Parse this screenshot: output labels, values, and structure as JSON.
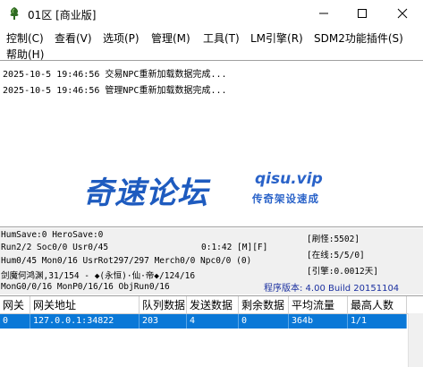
{
  "window": {
    "title": "01区 [商业版]",
    "icons": {
      "app": "tree-app-icon",
      "minimize": "minimize-icon",
      "maximize": "maximize-icon",
      "close": "close-icon"
    }
  },
  "menu": {
    "items": [
      "控制(C)",
      "查看(V)",
      "选项(P)",
      "管理(M)",
      "工具(T)",
      "LM引擎(R)",
      "SDM2功能插件(S)",
      "帮助(H)"
    ]
  },
  "log": {
    "lines": [
      "2025-10-5 19:46:56 交易NPC重新加载数据完成...",
      "2025-10-5 19:46:56 管理NPC重新加载数据完成..."
    ]
  },
  "watermark": {
    "main": "奇速论坛",
    "domain": "qisu.vip",
    "sub": "传奇架设速成"
  },
  "status": {
    "humsave": "HumSave:0 HeroSave:0",
    "run": "Run2/2 Soc0/0 Usr0/45",
    "time": "0:1:42 [M][F]",
    "hum": "Hum0/45 Mon0/16 UsrRot297/297 Merch0/0 Npc0/0 (0)",
    "npc": "剑魔何鸿渊,31/154 - ◆(永恒)·仙·帝◆/124/16",
    "mon": "MonG0/0/16 MonP0/16/16 ObjRun0/16",
    "refresh": "[刷怪:5502]",
    "online": "[在线:5/5/0]",
    "engine": "[引擎:0.0012天]",
    "version": "程序版本: 4.00 Build 20151104",
    "accent_color": "#1a2fa0"
  },
  "table": {
    "headers": [
      "网关",
      "网关地址",
      "队列数据",
      "发送数据",
      "剩余数据",
      "平均流量",
      "最高人数"
    ],
    "rows": [
      [
        "0",
        "127.0.0.1:34822",
        "203",
        "4",
        "0",
        "364b",
        "1/1"
      ]
    ],
    "selected_color": "#0a78d7"
  }
}
